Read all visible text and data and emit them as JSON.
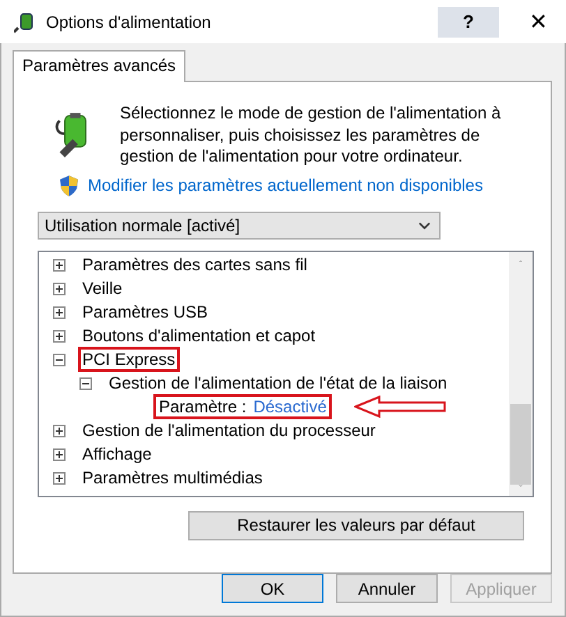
{
  "window": {
    "title": "Options d'alimentation",
    "help": "?",
    "close": "✕"
  },
  "tabs": [
    {
      "label": "Paramètres avancés",
      "selected": true
    }
  ],
  "intro": "Sélectionnez le mode de gestion de l'alimentation à personnaliser, puis choisissez les paramètres de gestion de l'alimentation pour votre ordinateur.",
  "link": "Modifier les paramètres actuellement non disponibles",
  "plan_select": {
    "value": "Utilisation normale [activé]"
  },
  "tree": [
    {
      "label": "Paramètres des cartes sans fil",
      "expanded": false,
      "highlighted": false
    },
    {
      "label": "Veille",
      "expanded": false,
      "highlighted": false
    },
    {
      "label": "Paramètres USB",
      "expanded": false,
      "highlighted": false
    },
    {
      "label": "Boutons d'alimentation et capot",
      "expanded": false,
      "highlighted": false
    },
    {
      "label": "PCI Express",
      "expanded": true,
      "highlighted": true,
      "children": [
        {
          "label": "Gestion de l'alimentation de l'état de la liaison",
          "expanded": true,
          "highlighted": false,
          "setting": {
            "label": "Paramètre :",
            "value": "Désactivé",
            "highlighted": true
          }
        }
      ]
    },
    {
      "label": "Gestion de l'alimentation du processeur",
      "expanded": false,
      "highlighted": false
    },
    {
      "label": "Affichage",
      "expanded": false,
      "highlighted": false
    },
    {
      "label": "Paramètres multimédias",
      "expanded": false,
      "highlighted": false
    }
  ],
  "restore_button": "Restaurer les valeurs par défaut",
  "buttons": [
    {
      "label": "OK",
      "disabled": false,
      "default": true
    },
    {
      "label": "Annuler",
      "disabled": false,
      "default": false
    },
    {
      "label": "Appliquer",
      "disabled": true,
      "default": false
    }
  ]
}
